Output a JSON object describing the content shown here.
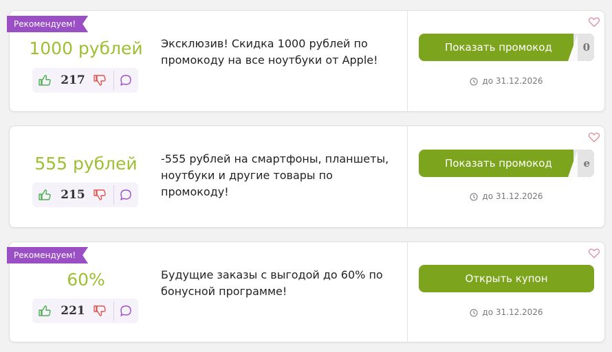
{
  "cards": [
    {
      "recommended": true,
      "ribbon": "Рекомендуем!",
      "amount": "1000 рублей",
      "votes": "217",
      "description": "Эксклюзив! Скидка 1000 рублей по промокоду на все ноутбуки от Apple!",
      "button": "Показать промокод",
      "code_peek": "0",
      "date": "до 31.12.2026"
    },
    {
      "recommended": false,
      "ribbon": "",
      "amount": "555 рублей",
      "votes": "215",
      "description": "-555 рублей на смартфоны, планшеты, ноутбуки и другие товары по промокоду!",
      "button": "Показать промокод",
      "code_peek": "e",
      "date": "до 31.12.2026"
    },
    {
      "recommended": true,
      "ribbon": "Рекомендуем!",
      "amount": "60%",
      "votes": "221",
      "description": "Будущие заказы с выгодой до 60% по бонусной программе!",
      "button": "Открыть купон",
      "code_peek": "",
      "date": "до 31.12.2026"
    }
  ],
  "colors": {
    "accent_green": "#7ca51d",
    "amount_green": "#9dc032",
    "ribbon_purple": "#9a4fc4",
    "like_green": "#4caf50",
    "dislike_red": "#e0554f",
    "comment_purple": "#9a4fc4",
    "heart_pink": "#e08a9a"
  },
  "icons": [
    "thumbs-up-icon",
    "thumbs-down-icon",
    "comment-icon",
    "clock-icon",
    "heart-icon"
  ]
}
